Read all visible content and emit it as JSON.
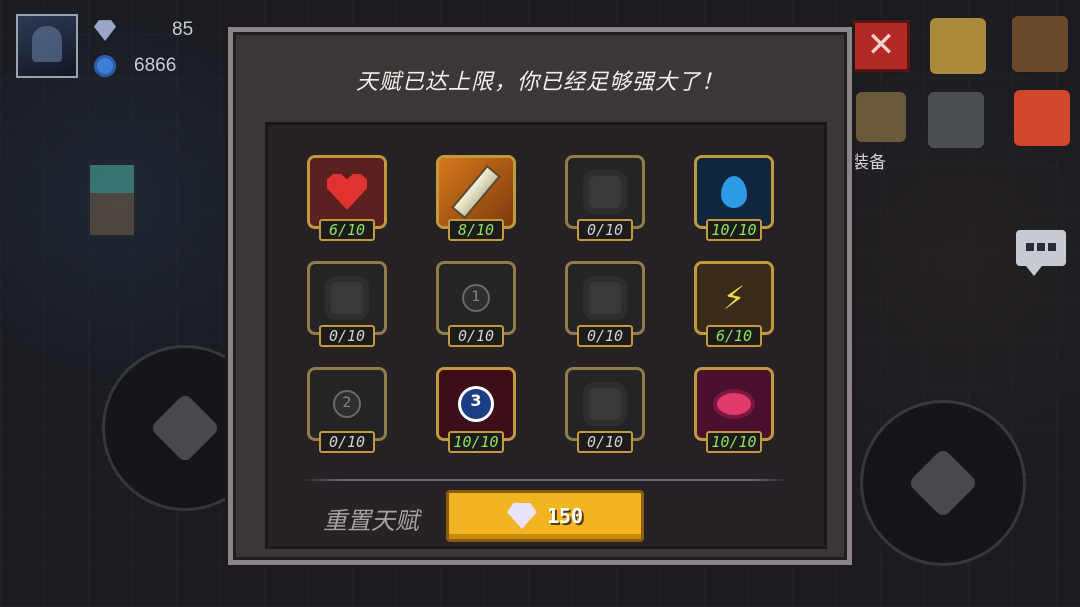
{
  "hud": {
    "gems": "85",
    "coins": "6866"
  },
  "side": {
    "close_icon": "close-x-icon",
    "equip_label": "装备"
  },
  "modal": {
    "title": "天赋已达上限，你已经足够强大了！",
    "reset_label": "重置天赋",
    "reset_cost": "150"
  },
  "talents": [
    {
      "icon": "heart-icon",
      "level": "6/10",
      "unlocked": true
    },
    {
      "icon": "sword-icon",
      "level": "8/10",
      "unlocked": true
    },
    {
      "icon": "locked-talent-icon",
      "level": "0/10",
      "unlocked": false
    },
    {
      "icon": "blue-drop-icon",
      "level": "10/10",
      "unlocked": true
    },
    {
      "icon": "locked-talent-icon",
      "level": "0/10",
      "unlocked": false
    },
    {
      "icon": "locked-talent-icon",
      "level": "0/10",
      "unlocked": false,
      "number": "1"
    },
    {
      "icon": "locked-talent-icon",
      "level": "0/10",
      "unlocked": false
    },
    {
      "icon": "lightning-icon",
      "level": "6/10",
      "unlocked": true
    },
    {
      "icon": "locked-talent-icon",
      "level": "0/10",
      "unlocked": false,
      "number": "2"
    },
    {
      "icon": "combo-3-icon",
      "level": "10/10",
      "unlocked": true,
      "number": "3"
    },
    {
      "icon": "locked-talent-icon",
      "level": "0/10",
      "unlocked": false
    },
    {
      "icon": "red-eye-icon",
      "level": "10/10",
      "unlocked": true
    }
  ],
  "colors": {
    "frame_gold": "#c09a3d",
    "level_active": "#8fe35a",
    "reset_button": "#f0b521",
    "modal_bg": "#3a3639"
  }
}
